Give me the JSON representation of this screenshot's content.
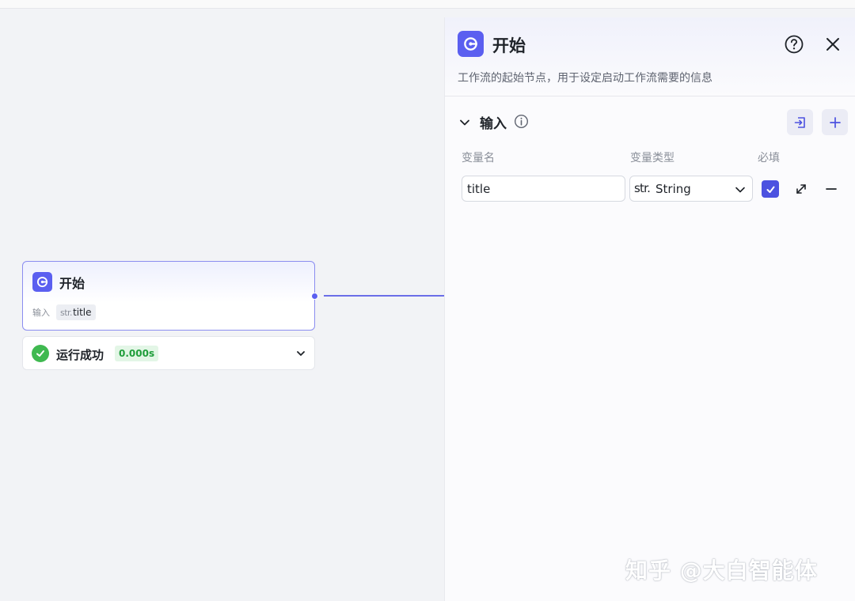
{
  "canvas": {
    "node": {
      "title": "开始",
      "input_label": "输入",
      "var_type": "str.",
      "var_name": "title",
      "icon": "start-node-icon"
    },
    "run": {
      "status_text": "运行成功",
      "duration": "0.000s",
      "status_icon": "success-check-icon"
    }
  },
  "panel": {
    "title": "开始",
    "description": "工作流的起始节点，用于设定启动工作流需要的信息",
    "section": {
      "title": "输入",
      "columns": {
        "name": "变量名",
        "type": "变量类型",
        "required": "必填"
      },
      "rows": [
        {
          "name": "title",
          "type_prefix": "str.",
          "type": "String",
          "required": true
        }
      ]
    }
  },
  "watermark": "知乎 @大白智能体",
  "colors": {
    "accent": "#5b5ff0",
    "success": "#3fb950",
    "canvas_bg": "#f2f3f6"
  }
}
